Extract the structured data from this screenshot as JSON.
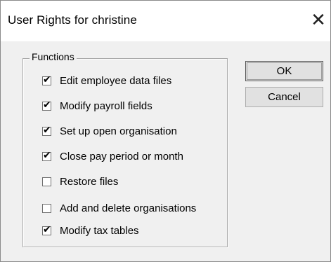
{
  "window": {
    "title": "User Rights for christine",
    "close_glyph": "✕"
  },
  "group": {
    "label": "Functions"
  },
  "functions": [
    {
      "label": "Edit employee data files",
      "checked": true
    },
    {
      "label": "Modify payroll fields",
      "checked": true
    },
    {
      "label": "Set up open organisation",
      "checked": true
    },
    {
      "label": "Close pay period or month",
      "checked": true
    },
    {
      "label": "Restore files",
      "checked": false
    },
    {
      "label": "Add and delete organisations",
      "checked": false
    },
    {
      "label": "Modify tax tables",
      "checked": true
    }
  ],
  "buttons": {
    "ok_label": "OK",
    "cancel_label": "Cancel"
  },
  "check_glyph": "✔"
}
